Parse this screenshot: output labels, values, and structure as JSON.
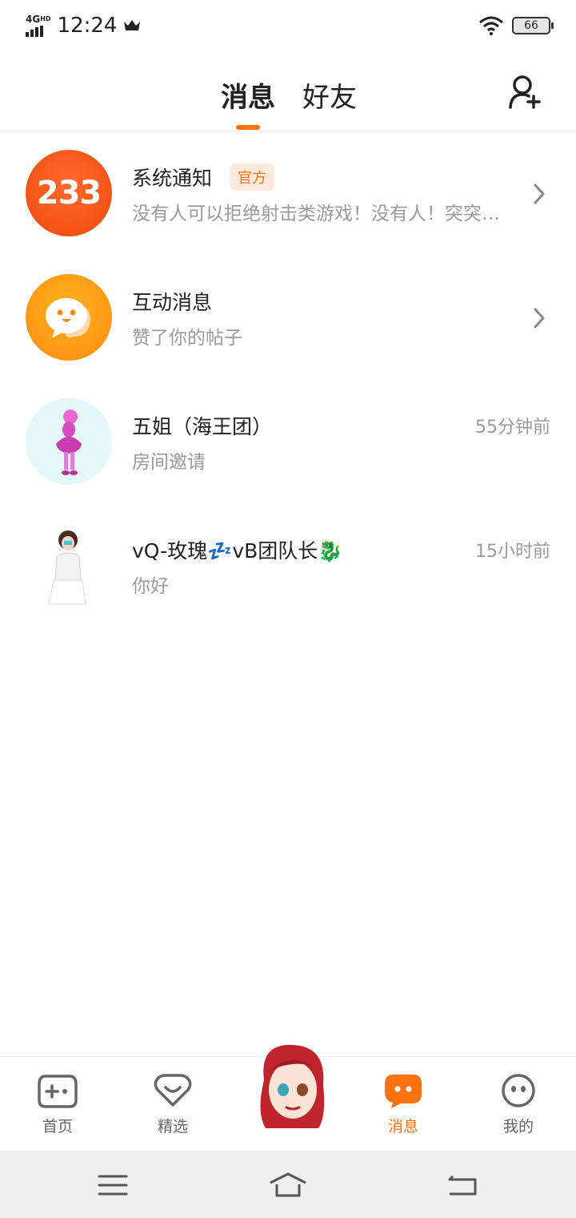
{
  "status_bar": {
    "network": "4G",
    "network_suffix": "HD",
    "time": "12:24",
    "battery": "66"
  },
  "header": {
    "tabs": [
      {
        "label": "消息",
        "active": true
      },
      {
        "label": "好友",
        "active": false
      }
    ],
    "add_friend_icon": "person-add-icon"
  },
  "conversations": [
    {
      "title": "系统通知",
      "badge": "官方",
      "subtitle": "没有人可以拒绝射击类游戏！没有人！突突突突",
      "avatar_text": "233"
    },
    {
      "title": "互动消息",
      "subtitle": "赞了你的帖子"
    },
    {
      "title": "五姐（海王团）",
      "subtitle": "房间邀请",
      "time": "55分钟前"
    },
    {
      "title": "vQ-玫瑰💤vB团队长🐉",
      "subtitle": "你好",
      "time": "15小时前"
    }
  ],
  "bottom_nav": {
    "items": [
      {
        "label": "首页",
        "icon": "gamepad-icon"
      },
      {
        "label": "精选",
        "icon": "heart-icon"
      },
      {
        "label": "消息",
        "icon": "message-icon",
        "active": true
      },
      {
        "label": "我的",
        "icon": "smiley-icon"
      }
    ]
  },
  "colors": {
    "accent": "#ff7210",
    "secondary_text": "#9b9b9b"
  }
}
